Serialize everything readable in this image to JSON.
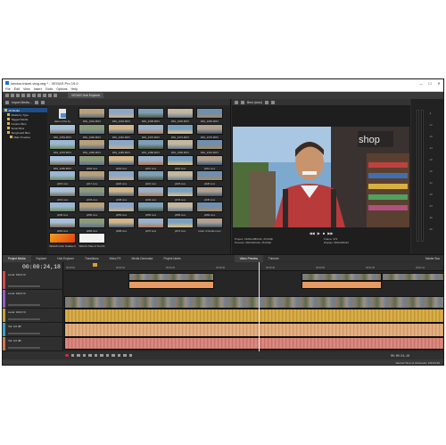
{
  "window": {
    "title": "london-travel-vlog.veg * - VEGAS Pro 19.0",
    "controls": [
      "—",
      "☐",
      "✕"
    ]
  },
  "menu": [
    "File",
    "Edit",
    "View",
    "Insert",
    "Tools",
    "Options",
    "Help"
  ],
  "hub_tab": "VEGAS Hub Explorer",
  "explorer": {
    "tab_label": "Import Media...",
    "tree": [
      "All Media",
      "Media by Type",
      "Tagged Media",
      "Custom Bins",
      "Smart Bins",
      "Storyboard Bins",
      "Main Timeline"
    ],
    "files": [
      {
        "name": "dawn of the by",
        "kind": "doc"
      },
      {
        "name": "IMG_2401.MOV",
        "kind": "video"
      },
      {
        "name": "IMG_2418.MOV",
        "kind": "video"
      },
      {
        "name": "IMG_2438.MOV",
        "kind": "video"
      },
      {
        "name": "IMG_2445.MOV",
        "kind": "video"
      },
      {
        "name": "IMG_2450.MOV",
        "kind": "video"
      },
      {
        "name": "IMG_2453.MOV",
        "kind": "video"
      },
      {
        "name": "IMG_2460.MOV",
        "kind": "video"
      },
      {
        "name": "IMG_2462.MOV",
        "kind": "video"
      },
      {
        "name": "IMG_2470.MOV",
        "kind": "video"
      },
      {
        "name": "IMG_2473.MOV",
        "kind": "video"
      },
      {
        "name": "IMG_2475.MOV",
        "kind": "video"
      },
      {
        "name": "IMG_2478.MOV",
        "kind": "video"
      },
      {
        "name": "IMG_2482.MOV",
        "kind": "video"
      },
      {
        "name": "IMG_2485.MOV",
        "kind": "video"
      },
      {
        "name": "IMG_2488.MOV",
        "kind": "video"
      },
      {
        "name": "IMG_2490.MOV",
        "kind": "video"
      },
      {
        "name": "IMG_2491.MOV",
        "kind": "video"
      },
      {
        "name": "IMG_2495.MOV",
        "kind": "video"
      },
      {
        "name": "p002.mov",
        "kind": "video"
      },
      {
        "name": "p004.mov",
        "kind": "video"
      },
      {
        "name": "p007.mov",
        "kind": "video"
      },
      {
        "name": "p010.mov",
        "kind": "video"
      },
      {
        "name": "p012.mov",
        "kind": "video"
      },
      {
        "name": "p015.mov",
        "kind": "video"
      },
      {
        "name": "p017.mov",
        "kind": "video"
      },
      {
        "name": "p020.mov",
        "kind": "video"
      },
      {
        "name": "p022.mov",
        "kind": "video"
      },
      {
        "name": "p025.mov",
        "kind": "video"
      },
      {
        "name": "p028.mov",
        "kind": "video"
      },
      {
        "name": "p031.mov",
        "kind": "video"
      },
      {
        "name": "p033.mov",
        "kind": "video"
      },
      {
        "name": "p038.mov",
        "kind": "video"
      },
      {
        "name": "p040.mov",
        "kind": "video"
      },
      {
        "name": "p043.mov",
        "kind": "video"
      },
      {
        "name": "p045.mov",
        "kind": "video"
      },
      {
        "name": "p048.mov",
        "kind": "video"
      },
      {
        "name": "p050.mov",
        "kind": "video"
      },
      {
        "name": "p053.mov",
        "kind": "video"
      },
      {
        "name": "p056.mov",
        "kind": "video"
      },
      {
        "name": "p058.mov",
        "kind": "video"
      },
      {
        "name": "p060.mov",
        "kind": "video"
      },
      {
        "name": "p063.mov",
        "kind": "video"
      },
      {
        "name": "p066.mov",
        "kind": "video"
      },
      {
        "name": "p068.mov",
        "kind": "video"
      },
      {
        "name": "p070.mov",
        "kind": "video"
      },
      {
        "name": "p072.mov",
        "kind": "video"
      },
      {
        "name": "tower of london.mov",
        "kind": "video"
      },
      {
        "name": "VEGAS Color Gradient 01",
        "kind": "gradient"
      },
      {
        "name": "VEGAS Titles & Text 01",
        "kind": "title"
      }
    ]
  },
  "preview": {
    "mode": "Best (Auto)",
    "controls": [
      "◀◀",
      "▶",
      "■",
      "▶▶"
    ],
    "info_left": [
      "Project: 1920x1080x32, 25,000p",
      "Preview: 960x540x32, 25,000p",
      "Video Preview",
      "Trimmer"
    ],
    "info_right": [
      "Frame: 372",
      "Display: 583x328x32"
    ]
  },
  "meters": {
    "label": "Master Bus",
    "scale": [
      "-6",
      "-12",
      "-18",
      "-24",
      "-30",
      "-36",
      "-42",
      "-48",
      "-54",
      "-60",
      "-66"
    ]
  },
  "dock_tabs": [
    "Project Media",
    "Explorer",
    "Hub Explorer",
    "Transitions",
    "Video FX",
    "Media Generator",
    "Project Notes",
    "Video Preview",
    "Trimmer",
    "Master Bus"
  ],
  "timeline": {
    "timecode": "00:00:24,18",
    "ruler_ticks": [
      "00:00:00",
      "00:00:10",
      "00:00:20",
      "00:00:30",
      "00:00:40",
      "00:00:50",
      "00:01:00",
      "00:01:10"
    ],
    "tracks": [
      {
        "name": "Level: 100,0 %",
        "type": "video",
        "color": "#d04a4a"
      },
      {
        "name": "Level: 100,0 %",
        "type": "video",
        "color": "#8c60c8"
      },
      {
        "name": "Level: 100,0 %",
        "type": "video",
        "color": "#c0a040"
      },
      {
        "name": "Vol: 0,0 dB",
        "type": "audio",
        "color": "#40a0c0"
      },
      {
        "name": "Vol: 0,0 dB",
        "type": "audio",
        "color": "#d07a50"
      }
    ],
    "end_timecode": "00:00:24,18",
    "rate": "Rate: 0,00",
    "status": "Record Time (2 channels): 136:23:30"
  },
  "colors": {
    "background": "#2b2b2b",
    "clip_orange": "#e89a60",
    "clip_audio": "#d8b040",
    "selection": "#1f4f8a"
  }
}
